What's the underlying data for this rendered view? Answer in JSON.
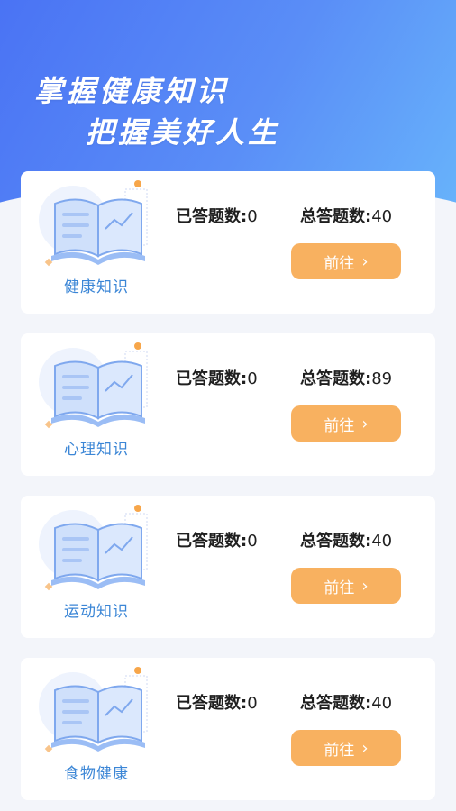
{
  "header": {
    "slogan_line1": "掌握健康知识",
    "slogan_line2": "把握美好人生"
  },
  "cards": [
    {
      "category": "健康知识",
      "answered_label": "已答题数:",
      "answered": "0",
      "total_label": "总答题数:",
      "total": "40",
      "button": "前往"
    },
    {
      "category": "心理知识",
      "answered_label": "已答题数:",
      "answered": "0",
      "total_label": "总答题数:",
      "total": "89",
      "button": "前往"
    },
    {
      "category": "运动知识",
      "answered_label": "已答题数:",
      "answered": "0",
      "total_label": "总答题数:",
      "total": "40",
      "button": "前往"
    },
    {
      "category": "食物健康",
      "answered_label": "已答题数:",
      "answered": "0",
      "total_label": "总答题数:",
      "total": "40",
      "button": "前往"
    }
  ],
  "icons": {
    "card_illustration": "open-book-icon",
    "button_arrow": "chevron-right-icon"
  },
  "colors": {
    "hero_start": "#4a73f4",
    "hero_end": "#68b4fb",
    "button": "#f8b160",
    "category_text": "#3b86d6"
  }
}
